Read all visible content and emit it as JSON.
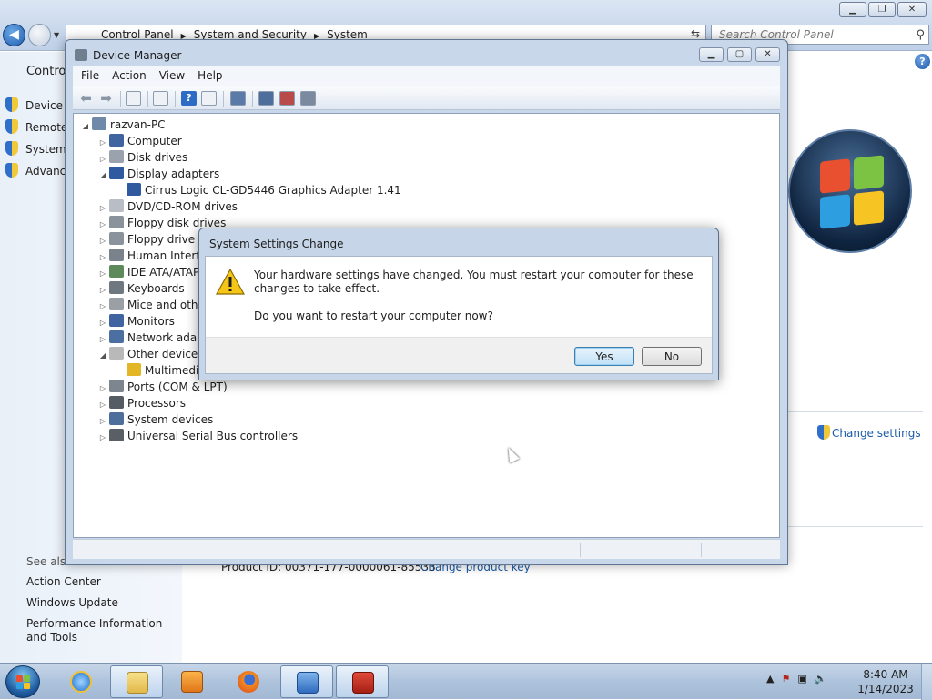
{
  "control_panel": {
    "breadcrumb": [
      "Control Panel",
      "System and Security",
      "System"
    ],
    "search_placeholder": "Search Control Panel",
    "side_home": "Control",
    "side_links": [
      "Device M",
      "Remote",
      "System",
      "Advanc"
    ],
    "see_also": "See also",
    "see_also_links": [
      "Action Center",
      "Windows Update",
      "Performance Information and Tools"
    ],
    "change_settings": "Change settings",
    "product_id": "Product ID: 00371-177-0000061-85533",
    "change_product_key": "Change product key"
  },
  "device_manager": {
    "title": "Device Manager",
    "menu": [
      "File",
      "Action",
      "View",
      "Help"
    ],
    "tree": [
      {
        "label": "razvan-PC",
        "level": 0,
        "expander": "expanded",
        "icon": "computer-icon"
      },
      {
        "label": "Computer",
        "level": 1,
        "expander": "collapsed",
        "icon": "monitor-icon"
      },
      {
        "label": "Disk drives",
        "level": 1,
        "expander": "collapsed",
        "icon": "disk-icon"
      },
      {
        "label": "Display adapters",
        "level": 1,
        "expander": "expanded",
        "icon": "display-adapter-icon"
      },
      {
        "label": "Cirrus Logic CL-GD5446 Graphics Adapter 1.41",
        "level": 2,
        "expander": "none",
        "icon": "display-adapter-icon"
      },
      {
        "label": "DVD/CD-ROM drives",
        "level": 1,
        "expander": "collapsed",
        "icon": "dvd-icon"
      },
      {
        "label": "Floppy disk drives",
        "level": 1,
        "expander": "collapsed",
        "icon": "floppy-icon"
      },
      {
        "label": "Floppy drive c",
        "level": 1,
        "expander": "collapsed",
        "icon": "floppy-icon"
      },
      {
        "label": "Human Interfa",
        "level": 1,
        "expander": "collapsed",
        "icon": "hid-icon"
      },
      {
        "label": "IDE ATA/ATAP",
        "level": 1,
        "expander": "collapsed",
        "icon": "ide-icon"
      },
      {
        "label": "Keyboards",
        "level": 1,
        "expander": "collapsed",
        "icon": "keyboard-icon"
      },
      {
        "label": "Mice and othe",
        "level": 1,
        "expander": "collapsed",
        "icon": "mouse-icon"
      },
      {
        "label": "Monitors",
        "level": 1,
        "expander": "collapsed",
        "icon": "monitor-icon"
      },
      {
        "label": "Network adap",
        "level": 1,
        "expander": "collapsed",
        "icon": "network-icon"
      },
      {
        "label": "Other devices",
        "level": 1,
        "expander": "expanded",
        "icon": "unknown-device-icon"
      },
      {
        "label": "Multimedi",
        "level": 2,
        "expander": "none",
        "icon": "warning-device-icon"
      },
      {
        "label": "Ports (COM & LPT)",
        "level": 1,
        "expander": "collapsed",
        "icon": "port-icon"
      },
      {
        "label": "Processors",
        "level": 1,
        "expander": "collapsed",
        "icon": "processor-icon"
      },
      {
        "label": "System devices",
        "level": 1,
        "expander": "collapsed",
        "icon": "system-device-icon"
      },
      {
        "label": "Universal Serial Bus controllers",
        "level": 1,
        "expander": "collapsed",
        "icon": "usb-icon"
      }
    ]
  },
  "dialog": {
    "title": "System Settings Change",
    "message": "Your hardware settings have changed. You must restart your computer for these changes to take effect.",
    "question": "Do you want to restart your computer now?",
    "yes_label": "Yes",
    "no_label": "No"
  },
  "taskbar": {
    "time": "8:40 AM",
    "date": "1/14/2023",
    "tasks": [
      "internet-explorer-icon",
      "file-explorer-icon",
      "media-player-icon",
      "firefox-icon",
      "control-panel-icon",
      "toolbox-icon"
    ]
  },
  "colors": {
    "accent_link": "#1a5aa6",
    "title_bar": "#c8d7ea",
    "dialog_default_button": "#c0e0f6"
  }
}
